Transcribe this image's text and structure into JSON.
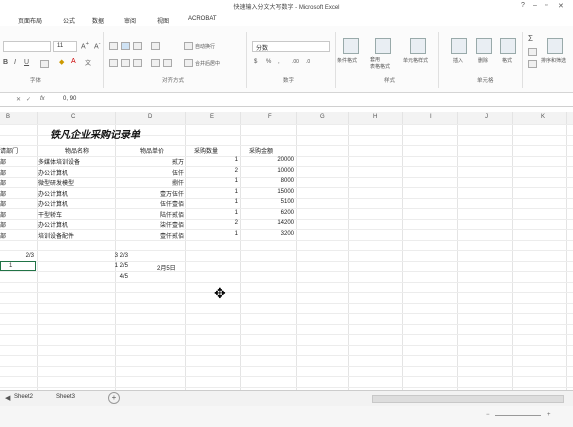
{
  "window": {
    "title": "快速输入分文大写数字 - Microsoft Excel"
  },
  "tabs": [
    "页面布局",
    "公式",
    "数据",
    "审阅",
    "视图",
    "ACROBAT"
  ],
  "ribbon": {
    "font_size": "11",
    "wrap_label": "自动换行",
    "merge_label": "合并后居中",
    "number_format": "分数",
    "styles": [
      "条件格式",
      "套用\n表格格式",
      "单元格样式"
    ],
    "cells": [
      "插入",
      "删除",
      "格式"
    ],
    "edit": [
      "排序和筛选"
    ],
    "groups": [
      "字体",
      "对齐方式",
      "数字",
      "样式",
      "单元格"
    ]
  },
  "formula_bar": {
    "fx": "fx",
    "value": "0, 90"
  },
  "columns": [
    "B",
    "C",
    "D",
    "E",
    "F",
    "G",
    "H",
    "I",
    "J",
    "K"
  ],
  "sheet": {
    "title": "铁凡企业采购记录单",
    "headers": [
      "请部门",
      "物品名称",
      "物品单价",
      "采购数量",
      "采购金额"
    ],
    "rows": [
      {
        "dept": "部",
        "item": "多媒体培训设备",
        "price": "贰万",
        "qty": "1",
        "amount": "20000"
      },
      {
        "dept": "部",
        "item": "办公计算机",
        "price": "伍仟",
        "qty": "2",
        "amount": "10000"
      },
      {
        "dept": "部",
        "item": "微型研发模型",
        "price": "捌仟",
        "qty": "1",
        "amount": "8000"
      },
      {
        "dept": "部",
        "item": "办公计算机",
        "price": "壹万伍仟",
        "qty": "1",
        "amount": "15000"
      },
      {
        "dept": "部",
        "item": "办公计算机",
        "price": "伍仟壹佰",
        "qty": "1",
        "amount": "5100"
      },
      {
        "dept": "部",
        "item": "干型轿车",
        "price": "陆仟贰佰",
        "qty": "1",
        "amount": "6200"
      },
      {
        "dept": "部",
        "item": "办公计算机",
        "price": "柒仟壹佰",
        "qty": "2",
        "amount": "14200"
      },
      {
        "dept": "部",
        "item": "培训设备配件",
        "price": "壹仟贰佰",
        "qty": "1",
        "amount": "3200"
      }
    ],
    "extra": {
      "b_frac": "2/3",
      "c1": "3 2/3",
      "c2": "1 2/5",
      "c3": "4/5",
      "d_date": "2月5日",
      "sel": "1"
    }
  },
  "sheet_tabs": [
    "Sheet2",
    "Sheet3"
  ]
}
